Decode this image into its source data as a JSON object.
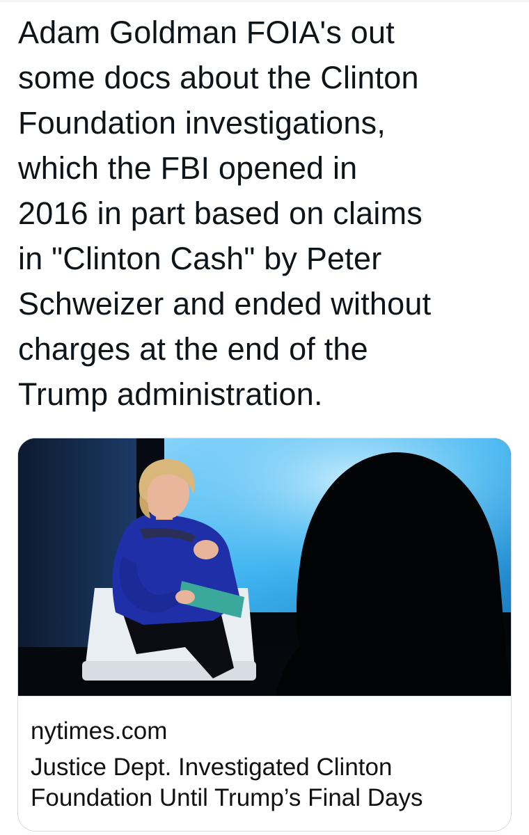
{
  "tweet": {
    "text": "Adam Goldman FOIA's out\nsome docs about the  Clinton\nFoundation investigations,\nwhich the FBI opened in\n2016 in part based on claims\nin \"Clinton Cash\" by Peter\nSchweizer and ended without\ncharges at the end of the\nTrump administration."
  },
  "link_card": {
    "domain": "nytimes.com",
    "title_line1": "Justice Dept. Investigated Clinton",
    "title_line2": "Foundation Until Trump’s Final Days",
    "image_icon": "photo-woman-seated-on-stage"
  },
  "colors": {
    "text": "#0f1419",
    "card_border": "#d6dbe0",
    "stage_blue": "#3fb4f0",
    "dress_blue": "#1e2fa8"
  }
}
